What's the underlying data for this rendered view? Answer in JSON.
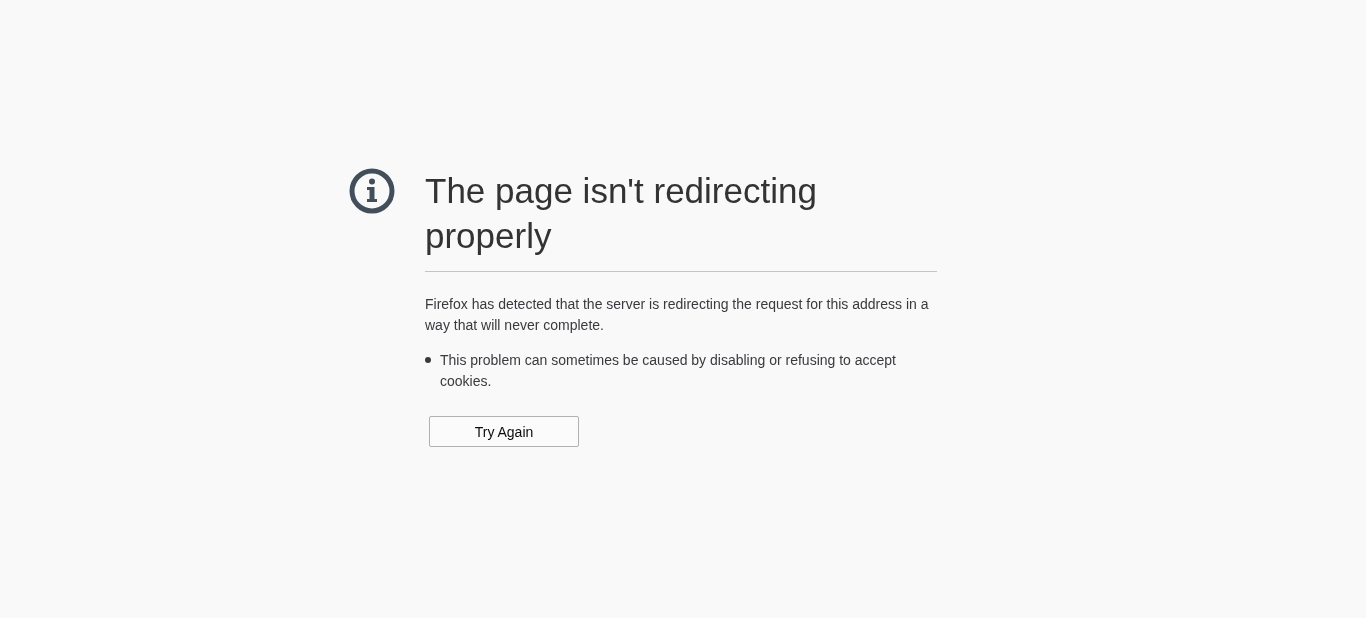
{
  "title": "The page isn't redirecting properly",
  "description": "Firefox has detected that the server is redirecting the request for this address in a way that will never complete.",
  "bullets": [
    "This problem can sometimes be caused by disabling or refusing to accept cookies."
  ],
  "button": {
    "label": "Try Again"
  }
}
